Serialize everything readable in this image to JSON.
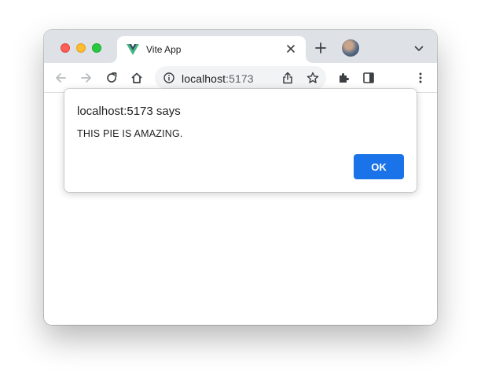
{
  "browser": {
    "tab": {
      "title": "Vite App",
      "favicon": "vue-logo-icon"
    },
    "address_bar": {
      "host": "localhost",
      "port": ":5173"
    },
    "colors": {
      "tabstrip": "#dee1e6",
      "omnibox": "#f1f3f4",
      "accent": "#1a73e8"
    }
  },
  "dialog": {
    "title": "localhost:5173 says",
    "message": "THIS PIE IS AMAZING.",
    "ok_label": "OK"
  }
}
